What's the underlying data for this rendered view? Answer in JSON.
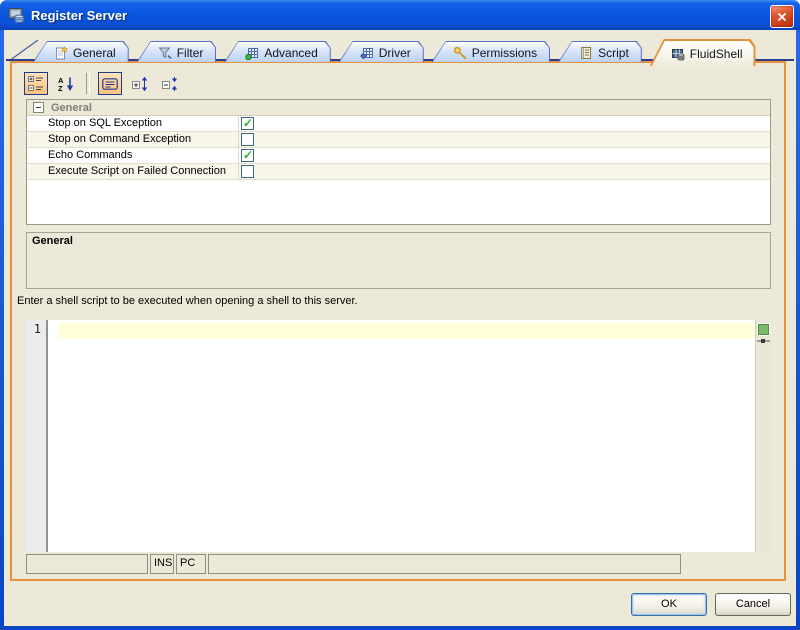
{
  "titlebar": {
    "title": "Register Server"
  },
  "tabs": [
    {
      "label": "General",
      "active": false
    },
    {
      "label": "Filter",
      "active": false
    },
    {
      "label": "Advanced",
      "active": false
    },
    {
      "label": "Driver",
      "active": false
    },
    {
      "label": "Permissions",
      "active": false
    },
    {
      "label": "Script",
      "active": false
    },
    {
      "label": "FluidShell",
      "active": true
    }
  ],
  "toolbar": {
    "buttons": [
      {
        "name": "categorized",
        "pressed": true
      },
      {
        "name": "sort-alphabetical",
        "pressed": false
      },
      {
        "name": "show-description",
        "pressed": true
      },
      {
        "name": "expand-all",
        "pressed": false
      },
      {
        "name": "collapse-all",
        "pressed": false
      }
    ]
  },
  "property_grid": {
    "category": "General",
    "rows": [
      {
        "label": "Stop on SQL Exception",
        "checked": true
      },
      {
        "label": "Stop on Command Exception",
        "checked": false
      },
      {
        "label": "Echo Commands",
        "checked": true
      },
      {
        "label": "Execute Script on Failed Connection",
        "checked": false
      }
    ]
  },
  "description_panel": {
    "title": "General",
    "body": ""
  },
  "instruction": "Enter a shell script to be executed when opening a shell to this server.",
  "editor": {
    "lines": [
      {
        "number": "1",
        "text": ""
      }
    ]
  },
  "status_bar": {
    "cells": [
      "",
      "INS",
      "PC",
      ""
    ]
  },
  "footer": {
    "ok_label": "OK",
    "cancel_label": "Cancel"
  },
  "colors": {
    "accent_orange": "#e8913a",
    "titlebar_blue": "#0b50d6",
    "check_green": "#2eb434",
    "current_line_yellow": "#ffffdb",
    "dialog_beige": "#ece9d8"
  }
}
